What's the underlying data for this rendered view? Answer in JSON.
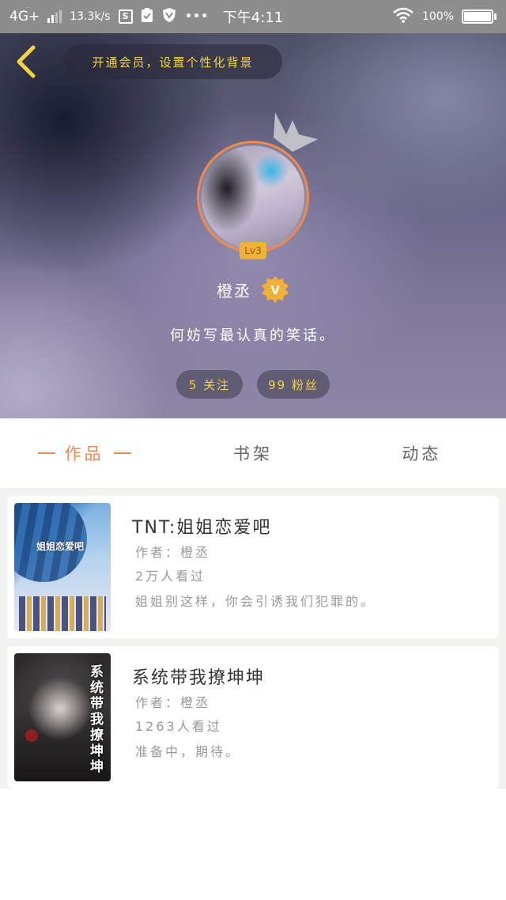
{
  "status_bar": {
    "network": "4G+",
    "speed": "13.3k/s",
    "time": "下午4:11",
    "battery": "100%",
    "battery_level": 1.0,
    "more": "•••"
  },
  "header": {
    "banner": "开通会员，设置个性化背景",
    "level": "Lv3",
    "username": "橙丞",
    "vip_label": "V",
    "bio": "何妨写最认真的笑话。",
    "following": "5 关注",
    "fans": "99 粉丝"
  },
  "tabs": [
    {
      "label": "作品",
      "active": true
    },
    {
      "label": "书架",
      "active": false
    },
    {
      "label": "动态",
      "active": false
    }
  ],
  "works": [
    {
      "title": "TNT:姐姐恋爱吧",
      "author": "作者：橙丞",
      "views": "2万人看过",
      "desc": "姐姐别这样，你会引诱我们犯罪的。",
      "cover_text": "姐姐恋爱吧"
    },
    {
      "title": "系统带我撩坤坤",
      "author": "作者：橙丞",
      "views": "1263人看过",
      "desc": "准备中，期待。",
      "cover_text": "系统带我撩坤坤"
    }
  ],
  "colors": {
    "accent": "#ef8a4b",
    "gold": "#f5d33c",
    "status_bar": "#8d8d8d"
  },
  "icons": {
    "back": "chevron-left-icon",
    "vip": "vip-badge-icon",
    "crown": "crown-icon",
    "wifi": "wifi-icon",
    "battery": "battery-icon"
  }
}
